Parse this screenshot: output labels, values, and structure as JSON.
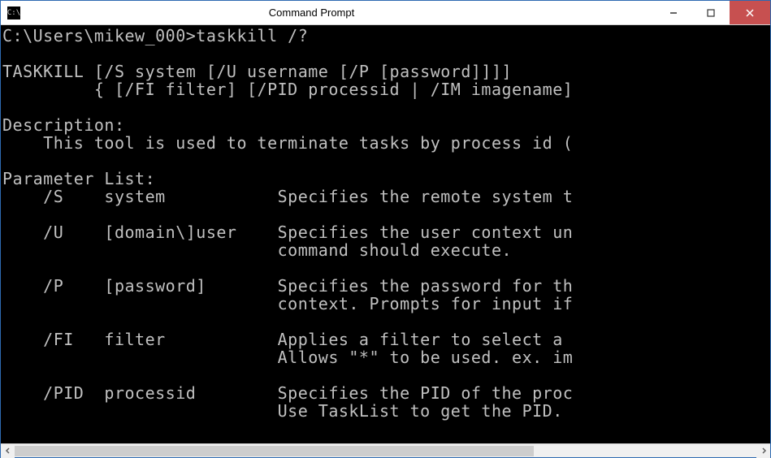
{
  "window": {
    "title": "Command Prompt",
    "icon_text": "C:\\"
  },
  "terminal": {
    "prompt": "C:\\Users\\mikew_000>",
    "command": "taskkill /?",
    "output_lines": [
      "",
      "TASKKILL [/S system [/U username [/P [password]]]]",
      "         { [/FI filter] [/PID processid | /IM imagename]",
      "",
      "Description:",
      "    This tool is used to terminate tasks by process id (",
      "",
      "Parameter List:",
      "    /S    system           Specifies the remote system t",
      "",
      "    /U    [domain\\]user    Specifies the user context un",
      "                           command should execute.",
      "",
      "    /P    [password]       Specifies the password for th",
      "                           context. Prompts for input if",
      "",
      "    /FI   filter           Applies a filter to select a ",
      "                           Allows \"*\" to be used. ex. im",
      "",
      "    /PID  processid        Specifies the PID of the proc",
      "                           Use TaskList to get the PID."
    ]
  }
}
